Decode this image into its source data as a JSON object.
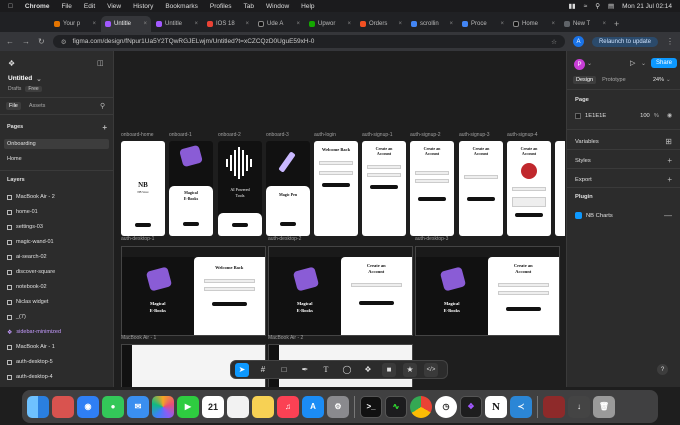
{
  "menubar": {
    "app": "Chrome",
    "items": [
      "File",
      "Edit",
      "View",
      "History",
      "Bookmarks",
      "Profiles",
      "Tab",
      "Window",
      "Help"
    ],
    "datetime": "Mon 21 Jul 02:14"
  },
  "tabs": [
    {
      "label": "Your p",
      "color": "#e37400"
    },
    {
      "label": "Untitle",
      "color": "#a259ff",
      "active": true
    },
    {
      "label": "Untitle",
      "color": "#a259ff"
    },
    {
      "label": "IOS 18",
      "color": "#ea4335"
    },
    {
      "label": "Ude A",
      "color": "#111111"
    },
    {
      "label": "Upwor",
      "color": "#14a800"
    },
    {
      "label": "Orders",
      "color": "#f25022"
    },
    {
      "label": "scrollin",
      "color": "#4285f4"
    },
    {
      "label": "Proce",
      "color": "#4285f4"
    },
    {
      "label": "Home",
      "color": "#111111"
    },
    {
      "label": "New T",
      "color": "#5f6368"
    }
  ],
  "address": {
    "url": "figma.com/design/fNpur1Ua5Y2TQwRGJELwjm/Untitled?t=xCZCQzD0UguE59xH-0",
    "avatar": "A",
    "relaunch": "Relaunch to update"
  },
  "left_panel": {
    "file_name": "Untitled",
    "drafts": "Drafts",
    "plan": "Free",
    "tabs": [
      "File",
      "Assets"
    ],
    "pages_title": "Pages",
    "pages": [
      "Onboarding",
      "Home"
    ],
    "layers_title": "Layers",
    "layers": [
      "MacBook Air - 2",
      "home-01",
      "settings-03",
      "magic-wand-01",
      "ai-search-02",
      "discover-square",
      "notebook-02",
      "Niclas widget",
      "_(7)",
      "sidebar-minimized",
      "MacBook Air - 1",
      "auth-desktop-5",
      "auth-desktop-4"
    ]
  },
  "canvas": {
    "frames_row1": [
      "onboard-home",
      "onboard-1",
      "onboard-2",
      "onboard-3",
      "auth-login",
      "auth-signup-1",
      "auth-signup-2",
      "auth-signup-3",
      "auth-signup-4"
    ],
    "frames_row2": [
      "auth-desktop-1",
      "auth-desktop-2",
      "auth-desktop-3"
    ],
    "frames_row3": [
      "MacBook Air - 1",
      "MacBook Air - 2"
    ],
    "texts": {
      "magical": "Magical",
      "ebooks": "E-Books",
      "ai_powered": "AI Powered",
      "tools": "Tools",
      "magic_pen": "Magic Pen",
      "welcome_back": "Welcome Back",
      "create_an": "Create an",
      "account": "Account",
      "nb_logo": "NB Store"
    }
  },
  "toolbar": {
    "tools": [
      "move",
      "frame",
      "rectangle",
      "pen",
      "text",
      "comment",
      "components",
      "dev",
      "ai",
      "code"
    ]
  },
  "right_panel": {
    "avatar": "P",
    "share": "Share",
    "tabs": [
      "Design",
      "Prototype"
    ],
    "zoom": "24%",
    "page_title": "Page",
    "page_color": "1E1E1E",
    "page_opacity": "100",
    "page_opacity_unit": "%",
    "sections": [
      "Variables",
      "Styles",
      "Export"
    ],
    "plugin_title": "Plugin",
    "plugin_name": "NB Charts"
  },
  "help": "?",
  "dock": [
    {
      "name": "finder",
      "color": "#3b8ef0"
    },
    {
      "name": "launchpad",
      "color": "#d9534f"
    },
    {
      "name": "safari",
      "color": "#2f7ff5"
    },
    {
      "name": "messages",
      "color": "#33c759"
    },
    {
      "name": "mail",
      "color": "#3a8ff0"
    },
    {
      "name": "photos",
      "color": "#e0a030"
    },
    {
      "name": "facetime",
      "color": "#2ecc40"
    },
    {
      "name": "calendar",
      "color": "#ffffff",
      "text": "21"
    },
    {
      "name": "reminders",
      "color": "#f2f2f2"
    },
    {
      "name": "notes",
      "color": "#f7d154"
    },
    {
      "name": "music",
      "color": "#fb4154"
    },
    {
      "name": "app-store",
      "color": "#1b8cf5"
    },
    {
      "name": "system-settings",
      "color": "#8a8a8e"
    },
    {
      "name": "terminal",
      "color": "#111111"
    },
    {
      "name": "activity-monitor",
      "color": "#1c1c1e"
    },
    {
      "name": "chrome",
      "color": "#ffffff"
    },
    {
      "name": "clock",
      "color": "#ffffff"
    },
    {
      "name": "figma",
      "color": "#1e1e1e"
    },
    {
      "name": "notion",
      "color": "#ffffff",
      "text": "N"
    },
    {
      "name": "vscode",
      "color": "#2b86d6"
    },
    {
      "name": "preview",
      "color": "#8e2a2a"
    },
    {
      "name": "downloads",
      "color": "#444444"
    },
    {
      "name": "trash",
      "color": "#9a9a9a"
    }
  ]
}
